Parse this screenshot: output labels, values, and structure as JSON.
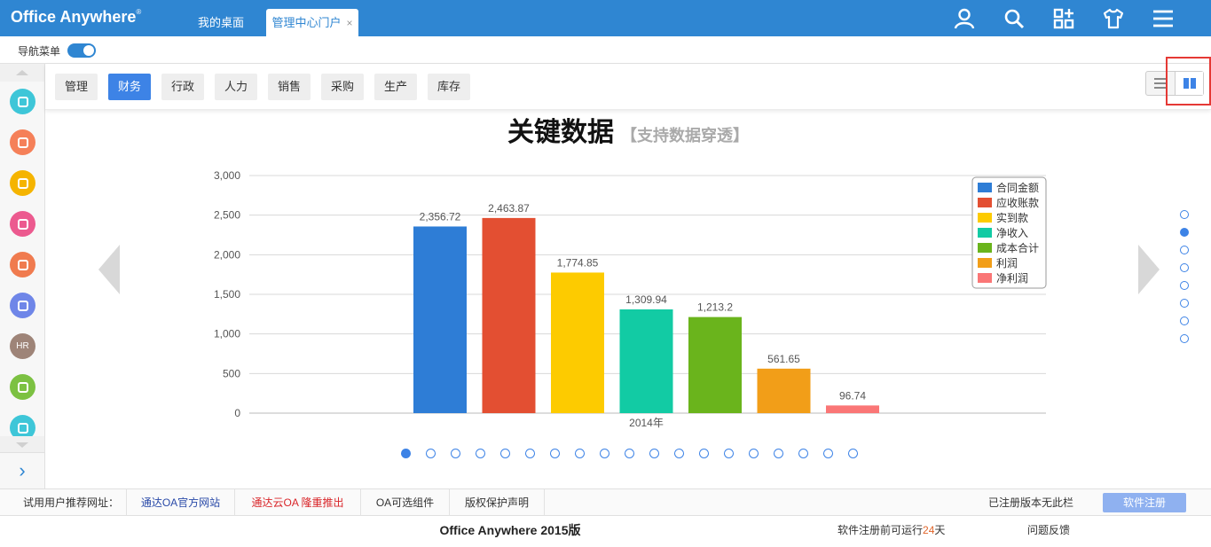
{
  "header": {
    "brand": "Office Anywhere",
    "brand_mark": "®",
    "tabs": [
      {
        "label": "我的桌面"
      },
      {
        "label": "管理中心门户",
        "close": "×"
      }
    ],
    "icons": [
      "user-icon",
      "search-icon",
      "apps-icon",
      "shirt-icon",
      "menu-icon"
    ]
  },
  "nav": {
    "label": "导航菜单",
    "toggle_on": true
  },
  "sidebar": {
    "icons": [
      {
        "name": "user-circle-icon",
        "color": "#3ec6d8"
      },
      {
        "name": "phone-icon",
        "color": "#f58059"
      },
      {
        "name": "layers-icon",
        "color": "#f5b400"
      },
      {
        "name": "book-icon",
        "color": "#ec5a8f"
      },
      {
        "name": "building-icon",
        "color": "#f07b4f"
      },
      {
        "name": "edit-icon",
        "color": "#6f86e8"
      },
      {
        "name": "hr-icon",
        "color": "#9e8478",
        "text": "HR"
      },
      {
        "name": "briefcase-icon",
        "color": "#7cc142"
      },
      {
        "name": "chat-icon",
        "color": "#3ec6d8"
      }
    ],
    "expand": "›"
  },
  "categories": [
    {
      "label": "管理",
      "active": false
    },
    {
      "label": "财务",
      "active": true
    },
    {
      "label": "行政",
      "active": false
    },
    {
      "label": "人力",
      "active": false
    },
    {
      "label": "销售",
      "active": false
    },
    {
      "label": "采购",
      "active": false
    },
    {
      "label": "生产",
      "active": false
    },
    {
      "label": "库存",
      "active": false
    }
  ],
  "panel": {
    "title": "关键数据",
    "subtitle": "【支持数据穿透】"
  },
  "chart_data": {
    "type": "bar",
    "categories": [
      "2014年"
    ],
    "series": [
      {
        "name": "合同金额",
        "values": [
          2356.72
        ],
        "label": "2,356.72",
        "color": "#2e7dd6"
      },
      {
        "name": "应收账款",
        "values": [
          2463.87
        ],
        "label": "2,463.87",
        "color": "#e34f32"
      },
      {
        "name": "实到款",
        "values": [
          1774.85
        ],
        "label": "1,774.85",
        "color": "#fdcb00"
      },
      {
        "name": "净收入",
        "values": [
          1309.94
        ],
        "label": "1,309.94",
        "color": "#12cba4"
      },
      {
        "name": "成本合计",
        "values": [
          1213.2
        ],
        "label": "1,213.2",
        "color": "#6ab41c"
      },
      {
        "name": "利润",
        "values": [
          561.65
        ],
        "label": "561.65",
        "color": "#f29e18"
      },
      {
        "name": "净利润",
        "values": [
          96.74
        ],
        "label": "96.74",
        "color": "#fa7676"
      }
    ],
    "yticks": [
      "0",
      "500",
      "1,000",
      "1,500",
      "2,000",
      "2,500",
      "3,000"
    ],
    "ylim": [
      0,
      3000
    ],
    "grid": true,
    "legend": "top-right"
  },
  "pager": {
    "bottom_count": 19,
    "bottom_active": 0,
    "right_count": 8,
    "right_active": 1
  },
  "footer": {
    "recommend_label": "试用用户推荐网址：",
    "links": [
      {
        "label": "通达OA官方网站",
        "color": "#2a4aa8"
      },
      {
        "label": "通达云OA 隆重推出",
        "color": "#d9262a"
      },
      {
        "label": "OA可选组件",
        "color": "#333333"
      },
      {
        "label": "版权保护声明",
        "color": "#333333"
      }
    ],
    "registered_note": "已注册版本无此栏",
    "register_button": "软件注册",
    "product": "Office Anywhere 2015版",
    "trial_prefix": "软件注册前可运行",
    "trial_days": "24",
    "trial_suffix": "天",
    "feedback": "问题反馈"
  }
}
